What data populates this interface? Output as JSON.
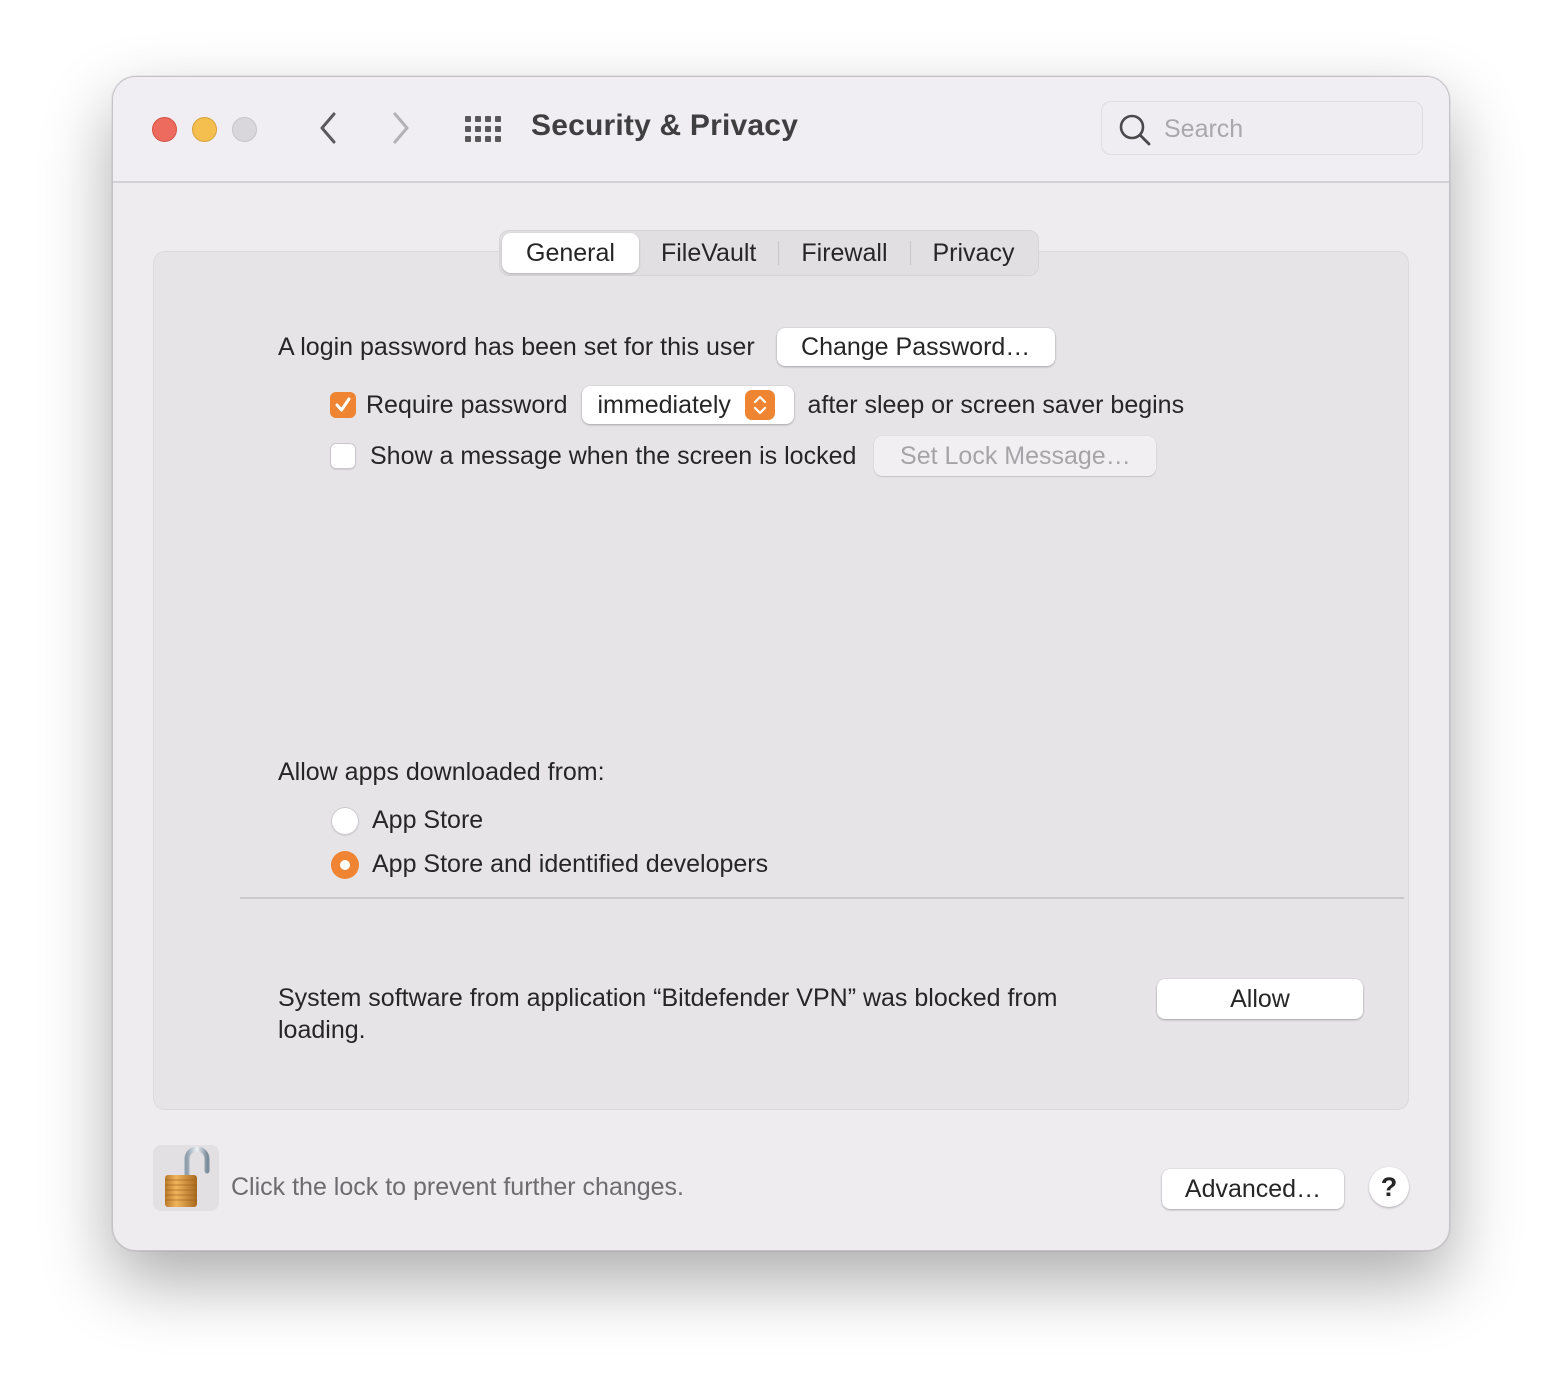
{
  "window": {
    "title": "Security & Privacy",
    "search": {
      "placeholder": "Search",
      "value": ""
    }
  },
  "tabs": [
    {
      "label": "General",
      "active": true
    },
    {
      "label": "FileVault",
      "active": false
    },
    {
      "label": "Firewall",
      "active": false
    },
    {
      "label": "Privacy",
      "active": false
    }
  ],
  "general": {
    "login_password_text": "A login password has been set for this user",
    "change_password_label": "Change Password…",
    "require_password": {
      "checked": true,
      "label": "Require password",
      "selected_option": "immediately",
      "suffix": "after sleep or screen saver begins"
    },
    "show_message": {
      "checked": false,
      "label": "Show a message when the screen is locked",
      "button_label": "Set Lock Message…",
      "button_enabled": false
    },
    "allow_apps": {
      "heading": "Allow apps downloaded from:",
      "options": [
        {
          "label": "App Store",
          "selected": false
        },
        {
          "label": "App Store and identified developers",
          "selected": true
        }
      ]
    },
    "blocked_software": {
      "message": "System software from application “Bitdefender VPN” was blocked from loading.",
      "allow_label": "Allow"
    }
  },
  "footer": {
    "lock_state": "unlocked",
    "lock_text": "Click the lock to prevent further changes.",
    "advanced_label": "Advanced…",
    "help_label": "?"
  },
  "colors": {
    "accent": "#ef8433",
    "close": "#ed6a5e",
    "minimize": "#f5bf4f",
    "zoom_disabled": "#d9d7db"
  }
}
